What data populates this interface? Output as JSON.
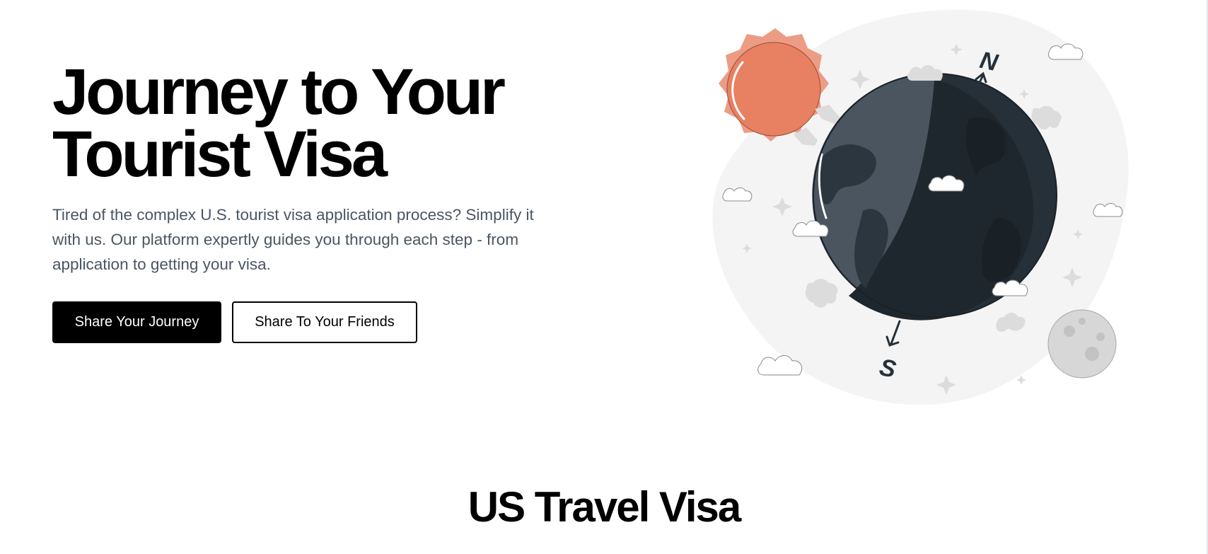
{
  "hero": {
    "title_line1": "Journey to Your",
    "title_line2": "Tourist Visa",
    "description": "Tired of the complex U.S. tourist visa application process? Simplify it with us. Our platform expertly guides you through each step - from application to getting your visa.",
    "primary_button": "Share Your Journey",
    "secondary_button": "Share To Your Friends"
  },
  "illustration": {
    "compass_north": "N",
    "compass_south": "S",
    "icons": [
      "sun-icon",
      "globe-icon",
      "moon-icon",
      "cloud-icon",
      "star-icon",
      "compass-arrow-icon"
    ]
  },
  "section": {
    "title": "US Travel Visa"
  },
  "colors": {
    "text_primary": "#000000",
    "text_secondary": "#4b5563",
    "sun": "#e88062",
    "sun_halo": "#ec9c85",
    "globe_dark": "#263038",
    "globe_light": "#4a5560",
    "blob_bg": "#f4f4f4",
    "moon": "#d7d7d7"
  }
}
